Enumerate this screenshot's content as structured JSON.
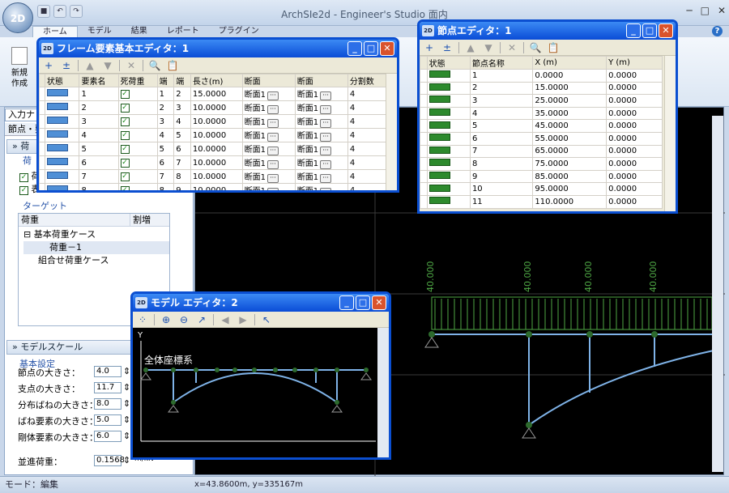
{
  "app": {
    "title": "ArchSIe2d - Engineer's Studio 面内",
    "orb_text": "2D"
  },
  "ribbon": {
    "tabs": [
      "ホーム",
      "モデル",
      "結果",
      "レポート",
      "プラグイン"
    ],
    "new_label": "新規\n作成"
  },
  "left_panel": {
    "tab_label": "入力ナ",
    "sub_label": "節点・要",
    "load_section": "荷",
    "group_label": "荷",
    "checks": [
      "荷",
      "表"
    ],
    "target_label": "ターゲット",
    "tree_header": [
      "荷重",
      "割増"
    ],
    "tree": [
      "基本荷重ケース",
      "荷重－1",
      "組合せ荷重ケース"
    ],
    "model_scale_label": "モデルスケール",
    "basic_settings": "基本設定",
    "fields": [
      {
        "label": "節点の大きさ：",
        "value": "4.0"
      },
      {
        "label": "支点の大きさ：",
        "value": "11.7"
      },
      {
        "label": "分布ばねの大きさ：",
        "value": "8.0"
      },
      {
        "label": "ばね要素の大きさ：",
        "value": "5.0"
      },
      {
        "label": "剛体要素の大きさ：",
        "value": "6.0"
      },
      {
        "label": "並進荷重：",
        "value": "0.1568",
        "unit": "m/kN"
      }
    ]
  },
  "frame_editor": {
    "title": "フレーム要素基本エディタ：1",
    "columns": [
      "状態",
      "要素名",
      "死荷重",
      "端",
      "端",
      "長さ(m)",
      "断面",
      "断面",
      "分割数"
    ],
    "rows": [
      [
        "1",
        "1",
        "2",
        "15.0000",
        "断面1",
        "断面1",
        "4"
      ],
      [
        "2",
        "2",
        "3",
        "10.0000",
        "断面1",
        "断面1",
        "4"
      ],
      [
        "3",
        "3",
        "4",
        "10.0000",
        "断面1",
        "断面1",
        "4"
      ],
      [
        "4",
        "4",
        "5",
        "10.0000",
        "断面1",
        "断面1",
        "4"
      ],
      [
        "5",
        "5",
        "6",
        "10.0000",
        "断面1",
        "断面1",
        "4"
      ],
      [
        "6",
        "6",
        "7",
        "10.0000",
        "断面1",
        "断面1",
        "4"
      ],
      [
        "7",
        "7",
        "8",
        "10.0000",
        "断面1",
        "断面1",
        "4"
      ],
      [
        "8",
        "8",
        "9",
        "10.0000",
        "断面1",
        "断面1",
        "4"
      ]
    ]
  },
  "node_editor": {
    "title": "節点エディタ：1",
    "columns": [
      "状態",
      "節点名称",
      "X (m)",
      "Y (m)"
    ],
    "rows": [
      [
        "1",
        "0.0000",
        "0.0000"
      ],
      [
        "2",
        "15.0000",
        "0.0000"
      ],
      [
        "3",
        "25.0000",
        "0.0000"
      ],
      [
        "4",
        "35.0000",
        "0.0000"
      ],
      [
        "5",
        "45.0000",
        "0.0000"
      ],
      [
        "6",
        "55.0000",
        "0.0000"
      ],
      [
        "7",
        "65.0000",
        "0.0000"
      ],
      [
        "8",
        "75.0000",
        "0.0000"
      ],
      [
        "9",
        "85.0000",
        "0.0000"
      ],
      [
        "10",
        "95.0000",
        "0.0000"
      ],
      [
        "11",
        "110.0000",
        "0.0000"
      ]
    ]
  },
  "model_editor": {
    "title": "モデル エディタ：2",
    "axis_y": "Y",
    "coord_label": "全体座標系"
  },
  "canvas": {
    "load_values": [
      "40.000",
      "40.000",
      "40.000",
      "40.000"
    ]
  },
  "status": {
    "mode": "モード：編集",
    "coords": "x=43.8600m, y=335167m"
  },
  "colors": {
    "titlebar": "#0a4cd6",
    "node": "#2d6a2d",
    "member": "#4f8fd6",
    "load": "#4fa845"
  }
}
